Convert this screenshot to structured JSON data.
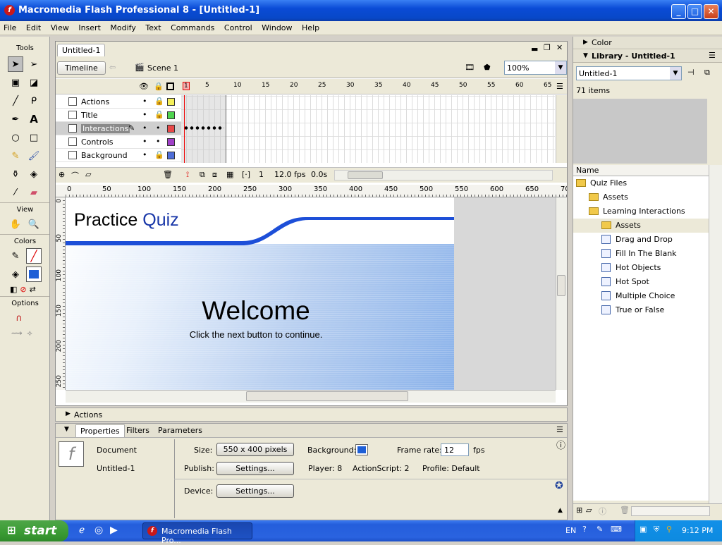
{
  "app": {
    "title": "Macromedia Flash Professional 8 - [Untitled-1]",
    "window_buttons": {
      "minimize": "_",
      "maximize": "□",
      "close": "✕"
    }
  },
  "menu": [
    "File",
    "Edit",
    "View",
    "Insert",
    "Modify",
    "Text",
    "Commands",
    "Control",
    "Window",
    "Help"
  ],
  "tools": {
    "title": "Tools",
    "view_label": "View",
    "colors_label": "Colors",
    "options_label": "Options"
  },
  "document": {
    "tab": "Untitled-1",
    "timeline_button": "Timeline",
    "scene": "Scene 1",
    "zoom": "100%",
    "frame_ruler": [
      "1",
      "5",
      "10",
      "15",
      "20",
      "25",
      "30",
      "35",
      "40",
      "45",
      "50",
      "55",
      "60",
      "65"
    ],
    "layers": [
      {
        "name": "Actions",
        "color": "#f5f05a"
      },
      {
        "name": "Title",
        "color": "#4fd44f"
      },
      {
        "name": "Interactions",
        "color": "#e84848"
      },
      {
        "name": "Controls",
        "color": "#a040c8"
      },
      {
        "name": "Background",
        "color": "#4f6ed8"
      }
    ],
    "status": {
      "frame": "1",
      "fps": "12.0 fps",
      "time": "0.0s"
    },
    "ruler": [
      "0",
      "50",
      "100",
      "150",
      "200",
      "250",
      "300",
      "350",
      "400",
      "450",
      "500",
      "550",
      "600",
      "650",
      "70"
    ],
    "vruler": [
      "0",
      "50",
      "100",
      "150",
      "200",
      "250"
    ]
  },
  "stage": {
    "title_part1": "Practice ",
    "title_part2": "Quiz",
    "welcome": "Welcome",
    "subtitle": "Click the next button to continue."
  },
  "actions_bar": {
    "label": "Actions"
  },
  "properties": {
    "tabs": [
      "Properties",
      "Filters",
      "Parameters"
    ],
    "doc_type": "Document",
    "doc_name": "Untitled-1",
    "size_label": "Size:",
    "size_value": "550 x 400 pixels",
    "background_label": "Background:",
    "background_color": "#1e5fd6",
    "framerate_label": "Frame rate:",
    "framerate_value": "12",
    "fps_label": "fps",
    "publish_label": "Publish:",
    "settings_label": "Settings...",
    "player_label": "Player: 8",
    "actionscript_label": "ActionScript:  2",
    "profile_label": "Profile:  Default",
    "device_label": "Device:",
    "device_settings_label": "Settings..."
  },
  "right_panel": {
    "color_title": "Color",
    "library_title": "Library - Untitled-1",
    "library_select": "Untitled-1",
    "item_count": "71 items",
    "name_header": "Name",
    "items": [
      {
        "name": "Quiz Files",
        "type": "folder",
        "indent": 0
      },
      {
        "name": "Assets",
        "type": "folder",
        "indent": 1
      },
      {
        "name": "Learning Interactions",
        "type": "folder",
        "indent": 1
      },
      {
        "name": "Assets",
        "type": "folder",
        "indent": 2
      },
      {
        "name": "Drag and Drop",
        "type": "symbol",
        "indent": 2
      },
      {
        "name": "Fill In The Blank",
        "type": "symbol",
        "indent": 2
      },
      {
        "name": "Hot Objects",
        "type": "symbol",
        "indent": 2
      },
      {
        "name": "Hot Spot",
        "type": "symbol",
        "indent": 2
      },
      {
        "name": "Multiple Choice",
        "type": "symbol",
        "indent": 2
      },
      {
        "name": "True or False",
        "type": "symbol",
        "indent": 2
      }
    ]
  },
  "taskbar": {
    "start": "start",
    "task": "Macromedia Flash Pro...",
    "lang": "EN",
    "time": "9:12 PM"
  }
}
